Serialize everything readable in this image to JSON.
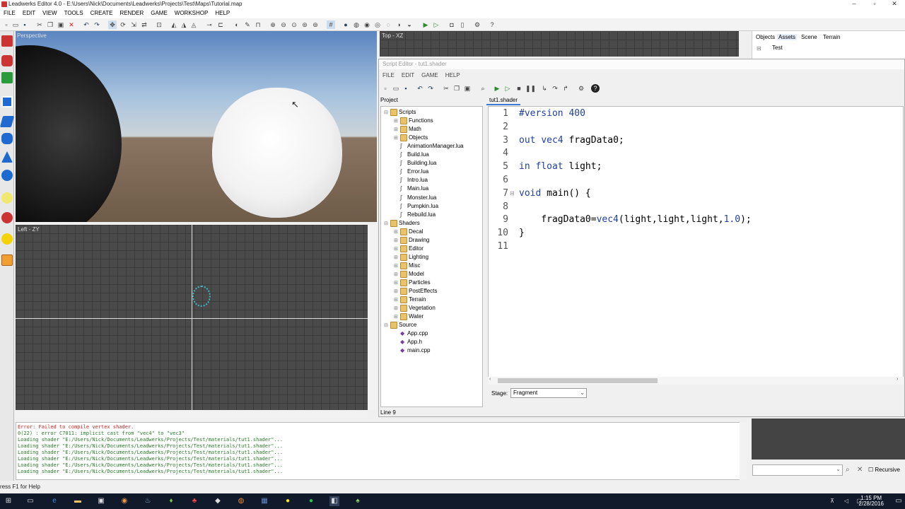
{
  "window": {
    "title": "Leadwerks Editor 4.0 - E:\\Users\\Nick\\Documents\\Leadwerks\\Projects\\Test\\Maps\\Tutorial.map"
  },
  "menu": [
    "FILE",
    "EDIT",
    "VIEW",
    "TOOLS",
    "CREATE",
    "RENDER",
    "GAME",
    "WORKSHOP",
    "HELP"
  ],
  "viewports": {
    "perspective": "Perspective",
    "left": "Left - ZY",
    "top": "Top - XZ"
  },
  "right_panel": {
    "tabs": [
      "Objects",
      "Assets",
      "Scene",
      "Terrain"
    ],
    "tree_root": "Test"
  },
  "script_editor": {
    "title": "Script Editor - tut1.shader",
    "menu": [
      "FILE",
      "EDIT",
      "GAME",
      "HELP"
    ],
    "project_label": "Project",
    "tab": "tut1.shader",
    "tree": [
      {
        "label": "Scripts",
        "type": "folder",
        "depth": 0,
        "expanded": true
      },
      {
        "label": "Functions",
        "type": "folder",
        "depth": 1
      },
      {
        "label": "Math",
        "type": "folder",
        "depth": 1
      },
      {
        "label": "Objects",
        "type": "folder",
        "depth": 1
      },
      {
        "label": "AnimationManager.lua",
        "type": "file",
        "depth": 1
      },
      {
        "label": "Build.lua",
        "type": "file",
        "depth": 1
      },
      {
        "label": "Building.lua",
        "type": "file",
        "depth": 1
      },
      {
        "label": "Error.lua",
        "type": "file",
        "depth": 1
      },
      {
        "label": "Intro.lua",
        "type": "file",
        "depth": 1
      },
      {
        "label": "Main.lua",
        "type": "file",
        "depth": 1
      },
      {
        "label": "Monster.lua",
        "type": "file",
        "depth": 1
      },
      {
        "label": "Pumpkin.lua",
        "type": "file",
        "depth": 1
      },
      {
        "label": "Rebuild.lua",
        "type": "file",
        "depth": 1
      },
      {
        "label": "Shaders",
        "type": "folder",
        "depth": 0,
        "expanded": true
      },
      {
        "label": "Decal",
        "type": "folder",
        "depth": 1
      },
      {
        "label": "Drawing",
        "type": "folder",
        "depth": 1
      },
      {
        "label": "Editor",
        "type": "folder",
        "depth": 1
      },
      {
        "label": "Lighting",
        "type": "folder",
        "depth": 1
      },
      {
        "label": "Misc",
        "type": "folder",
        "depth": 1
      },
      {
        "label": "Model",
        "type": "folder",
        "depth": 1
      },
      {
        "label": "Particles",
        "type": "folder",
        "depth": 1
      },
      {
        "label": "PostEffects",
        "type": "folder",
        "depth": 1
      },
      {
        "label": "Terrain",
        "type": "folder",
        "depth": 1
      },
      {
        "label": "Vegetation",
        "type": "folder",
        "depth": 1
      },
      {
        "label": "Water",
        "type": "folder",
        "depth": 1
      },
      {
        "label": "Source",
        "type": "folder",
        "depth": 0,
        "expanded": true
      },
      {
        "label": "App.cpp",
        "type": "src",
        "depth": 1
      },
      {
        "label": "App.h",
        "type": "src",
        "depth": 1
      },
      {
        "label": "main.cpp",
        "type": "src",
        "depth": 1
      }
    ],
    "code_lines": [
      "#version 400",
      "",
      "out vec4 fragData0;",
      "",
      "in float light;",
      "",
      "void main() {",
      "",
      "    fragData0=vec4(light,light,light,1.0);",
      "}",
      ""
    ],
    "stage_label": "Stage:",
    "stage_value": "Fragment",
    "status": "Line 9"
  },
  "output": [
    {
      "text": "Error: Failed to compile vertex shader.",
      "kind": "err"
    },
    {
      "text": "0(22) : error C7011: implicit cast from \"vec4\" to \"vec3\"",
      "kind": "ok"
    },
    {
      "text": "Loading shader \"E:/Users/Nick/Documents/Leadwerks/Projects/Test/materials/tut1.shader\"...",
      "kind": "ok"
    },
    {
      "text": "Loading shader \"E:/Users/Nick/Documents/Leadwerks/Projects/Test/materials/tut1.shader\"...",
      "kind": "ok"
    },
    {
      "text": "Loading shader \"E:/Users/Nick/Documents/Leadwerks/Projects/Test/materials/tut1.shader\"...",
      "kind": "ok"
    },
    {
      "text": "Loading shader \"E:/Users/Nick/Documents/Leadwerks/Projects/Test/materials/tut1.shader\"...",
      "kind": "ok"
    },
    {
      "text": "Loading shader \"E:/Users/Nick/Documents/Leadwerks/Projects/Test/materials/tut1.shader\"...",
      "kind": "ok"
    },
    {
      "text": "Loading shader \"E:/Users/Nick/Documents/Leadwerks/Projects/Test/materials/tut1.shader\"...",
      "kind": "ok"
    }
  ],
  "recursive_label": "Recursive",
  "status_bar": "ress F1 for Help",
  "clock": {
    "time": "1:15 PM",
    "date": "2/28/2016"
  },
  "colors": {
    "error": "#cc2222",
    "log": "#2a7a2a",
    "keyword": "#1f3fa0",
    "grid": "#4a4a4a",
    "taskbar": "#101a2a"
  }
}
